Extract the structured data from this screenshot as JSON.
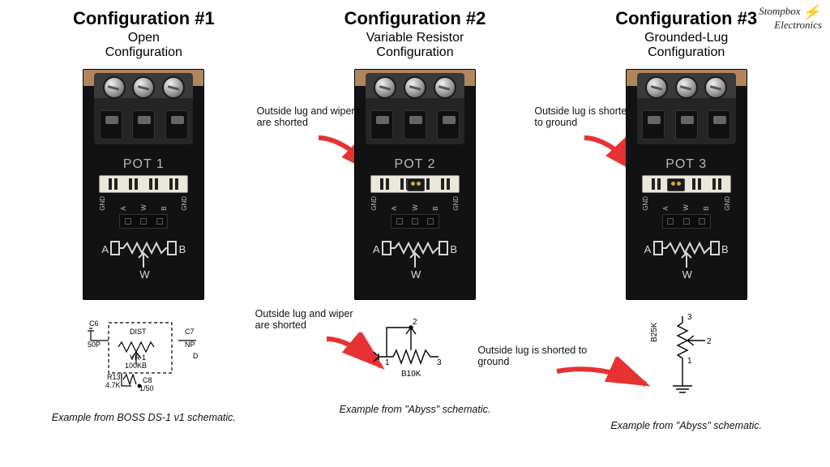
{
  "logo": {
    "line1": "Stompbox",
    "line2": "Electronics"
  },
  "configs": [
    {
      "title": "Configuration #1",
      "subtitle1": "Open",
      "subtitle2": "Configuration",
      "pot_label": "POT 1",
      "jumper_position": null,
      "legend": [
        "GND",
        "A",
        "W",
        "B",
        "GND"
      ],
      "caption": "Example from BOSS DS-1 v1 schematic.",
      "schematic_labels": {
        "dist": "DIST",
        "vr": "VR 1",
        "val": "100KB",
        "r": "R13",
        "rv": "4.7K",
        "c6": "C6",
        "c6v": "50P",
        "c7": "C7",
        "c7v": "NP",
        "c8": "C8",
        "c8v": "1/50",
        "d": "D"
      }
    },
    {
      "title": "Configuration #2",
      "subtitle1": "Variable Resistor",
      "subtitle2": "Configuration",
      "pot_label": "POT 2",
      "jumper_position": "center",
      "legend": [
        "GND",
        "A",
        "W",
        "B",
        "GND"
      ],
      "annot_top": "Outside lug and wiper are shorted",
      "annot_bottom": "Outside lug and wiper are shorted",
      "caption": "Example from \"Abyss\" schematic.",
      "schematic_labels": {
        "val": "B10K",
        "n1": "1",
        "n2": "2",
        "n3": "3"
      }
    },
    {
      "title": "Configuration #3",
      "subtitle1": "Grounded-Lug",
      "subtitle2": "Configuration",
      "pot_label": "POT 3",
      "jumper_position": "left-center",
      "legend": [
        "GND",
        "A",
        "W",
        "B",
        "GND"
      ],
      "annot_top": "Outside lug is shorted to ground",
      "annot_bottom": "Outside lug is shorted to ground",
      "caption": "Example from \"Abyss\" schematic.",
      "schematic_labels": {
        "val": "B25K",
        "n1": "1",
        "n2": "2",
        "n3": "3"
      }
    }
  ],
  "pot_terminals": {
    "a": "A",
    "b": "B",
    "w": "W"
  }
}
